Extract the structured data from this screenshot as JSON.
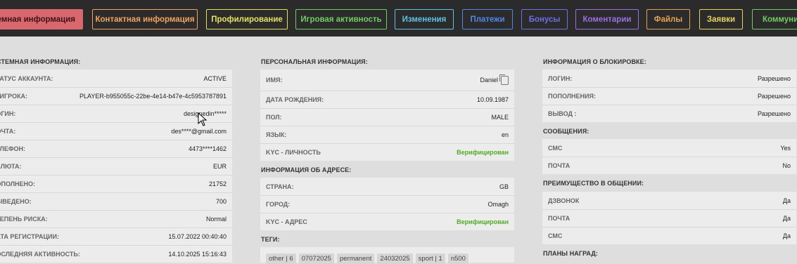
{
  "tabs": [
    {
      "label": "Системная информация",
      "color": "#d9686e",
      "active": true
    },
    {
      "label": "Контактная информация",
      "color": "#f5a35c"
    },
    {
      "label": "Профилирование",
      "color": "#e6e35b"
    },
    {
      "label": "Игровая активность",
      "color": "#6ecf5f"
    },
    {
      "label": "Изменения",
      "color": "#5bc3e6"
    },
    {
      "label": "Платежи",
      "color": "#4f86e8"
    },
    {
      "label": "Бонусы",
      "color": "#6e6ee8"
    },
    {
      "label": "Коментарии",
      "color": "#9b6ee8"
    },
    {
      "label": "Файлы",
      "color": "#e8a24f"
    },
    {
      "label": "Заявки",
      "color": "#e6d45b"
    },
    {
      "label": "Коммуникации",
      "color": "#6ecf5f"
    }
  ],
  "system": {
    "title": "СИСТЕМНАЯ ИНФОРМАЦИЯ:",
    "rows": [
      {
        "label": "СТАТУС АККАУНТА:",
        "value": "ACTIVE"
      },
      {
        "label": "ID ИГРОКА:",
        "value": "PLAYER-b955055c-22be-4e14-b47e-4c5953787891"
      },
      {
        "label": "ЛОГИН:",
        "value": "designedin*****"
      },
      {
        "label": "ПОЧТА:",
        "value": "des****@gmail.com"
      },
      {
        "label": "ТЕЛЕФОН:",
        "value": "4473****1462"
      },
      {
        "label": "ВАЛЮТА:",
        "value": "EUR"
      },
      {
        "label": "ПОПОЛНЕНО:",
        "value": "21752"
      },
      {
        "label": "ВЫВЕДЕНО:",
        "value": "700"
      },
      {
        "label": "СТЕПЕНЬ РИСКА:",
        "value": "Normal"
      },
      {
        "label": "ДАТА РЕГИСТРАЦИИ:",
        "value": "15.07.2022 00:40:40"
      },
      {
        "label": "ПОСЛЕДНЯЯ АКТИВНОСТЬ:",
        "value": "14.10.2025 15:16:43"
      }
    ]
  },
  "personal": {
    "title": "ПЕРСОНАЛЬНАЯ ИНФОРМАЦИЯ:",
    "rows": [
      {
        "label": "ИМЯ:",
        "value": "Daniel"
      },
      {
        "label": "ДАТА РОЖДЕНИЯ:",
        "value": "10.09.1987"
      },
      {
        "label": "ПОЛ:",
        "value": "MALE"
      },
      {
        "label": "ЯЗЫК:",
        "value": "en"
      },
      {
        "label": "KYC - ЛИЧНОСТЬ",
        "value": "Верифицирован"
      }
    ]
  },
  "address": {
    "title": "ИНФОРМАЦИЯ ОБ АДРЕСЕ:",
    "rows": [
      {
        "label": "СТРАНА:",
        "value": "GB"
      },
      {
        "label": "ГОРОД:",
        "value": "Omagh"
      },
      {
        "label": "KYC - АДРЕС",
        "value": "Верифицирован"
      }
    ]
  },
  "tags": {
    "title": "ТЕГИ:",
    "items": [
      "other | 6",
      "07072025",
      "permanent",
      "24032025",
      "sport | 1",
      "n500"
    ]
  },
  "blocking": {
    "title": "ИНФОРМАЦИЯ О БЛОКИРОВКЕ:",
    "rows": [
      {
        "label": "ЛОГИН:",
        "value": "Разрешено"
      },
      {
        "label": "ПОПОЛНЕНИЯ:",
        "value": "Разрешено"
      },
      {
        "label": "ВЫВОД :",
        "value": "Разрешено"
      }
    ]
  },
  "messages": {
    "title": "СООБЩЕНИЯ:",
    "rows": [
      {
        "label": "СМС",
        "value": "Yes"
      },
      {
        "label": "ПОЧТА",
        "value": "No"
      }
    ]
  },
  "comm_pref": {
    "title": "ПРЕИМУЩЕСТВО В ОБЩЕНИИ:",
    "rows": [
      {
        "label": "ДЗВОНОК",
        "value": "Да"
      },
      {
        "label": "ПОЧТА",
        "value": "Да"
      },
      {
        "label": "СМС",
        "value": "Да"
      }
    ]
  },
  "rewards": {
    "title": "ПЛАНЫ НАГРАД:"
  },
  "colors": {
    "verified": "#4caf1f",
    "page_bg": "#dedede",
    "topbar_bg": "#2b2b2b"
  }
}
